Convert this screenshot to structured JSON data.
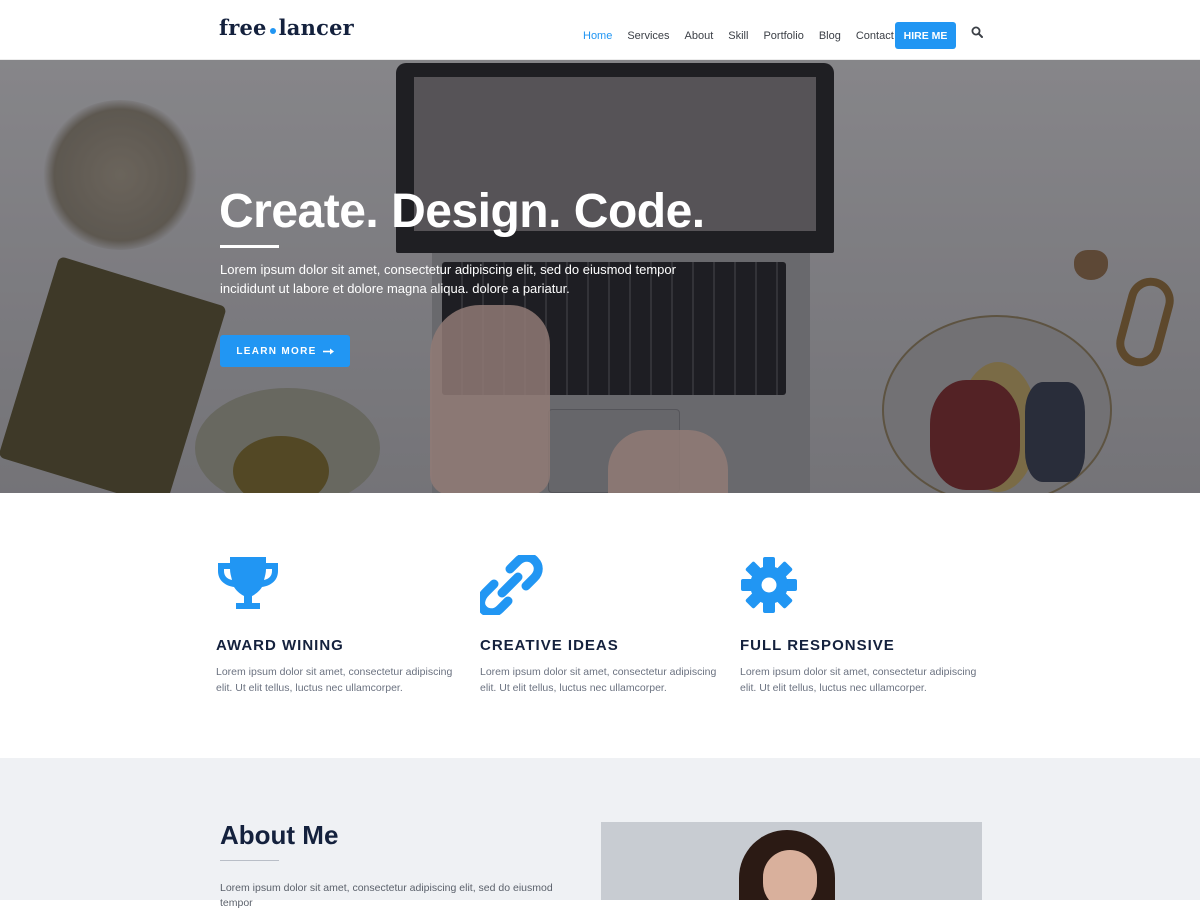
{
  "brand": {
    "logo_left": "free",
    "logo_right": "lancer",
    "accent": "#2196f3",
    "dark": "#14213d"
  },
  "nav": {
    "items": [
      "Home",
      "Services",
      "About",
      "Skill",
      "Portfolio",
      "Blog",
      "Contact"
    ],
    "active": "Home",
    "cta_label": "HIRE ME",
    "search_icon": "search-icon"
  },
  "hero": {
    "title": "Create. Design. Code.",
    "text": "Lorem ipsum dolor sit amet, consectetur adipiscing elit, sed do eiusmod tempor incididunt ut labore et dolore magna aliqua. dolore a pariatur.",
    "button_label": "LEARN MORE",
    "button_icon": "arrow-right-icon"
  },
  "features": [
    {
      "icon": "trophy-icon",
      "title": "AWARD WINING",
      "text": "Lorem ipsum dolor sit amet, consectetur adipiscing elit. Ut elit tellus, luctus nec ullamcorper."
    },
    {
      "icon": "link-icon",
      "title": "CREATIVE IDEAS",
      "text": "Lorem ipsum dolor sit amet, consectetur adipiscing elit. Ut elit tellus, luctus nec ullamcorper."
    },
    {
      "icon": "gear-icon",
      "title": "FULL RESPONSIVE",
      "text": "Lorem ipsum dolor sit amet, consectetur adipiscing elit. Ut elit tellus, luctus nec ullamcorper."
    }
  ],
  "about": {
    "title": "About Me",
    "text": "Lorem ipsum dolor sit amet, consectetur adipiscing elit, sed do eiusmod tempor"
  }
}
